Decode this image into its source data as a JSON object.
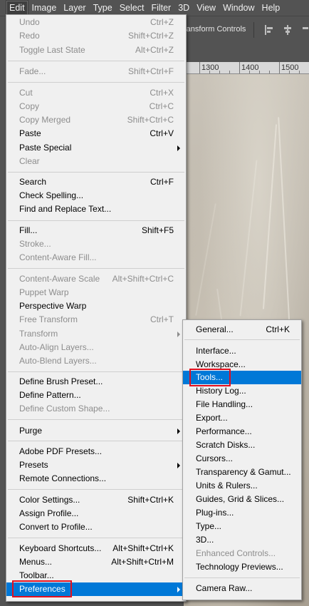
{
  "menubar": {
    "items": [
      "Edit",
      "Image",
      "Layer",
      "Type",
      "Select",
      "Filter",
      "3D",
      "View",
      "Window",
      "Help"
    ],
    "active": "Edit"
  },
  "options_bar": {
    "transform_controls_label": "ransform Controls"
  },
  "ruler": {
    "ticks": [
      "1300",
      "1400",
      "1500"
    ]
  },
  "edit_menu": {
    "items": [
      {
        "label": "Undo",
        "shortcut": "Ctrl+Z",
        "disabled": true
      },
      {
        "label": "Redo",
        "shortcut": "Shift+Ctrl+Z",
        "disabled": true
      },
      {
        "label": "Toggle Last State",
        "shortcut": "Alt+Ctrl+Z",
        "disabled": true
      },
      {
        "label": "Fade...",
        "shortcut": "Shift+Ctrl+F",
        "disabled": true
      },
      {
        "label": "Cut",
        "shortcut": "Ctrl+X",
        "disabled": true
      },
      {
        "label": "Copy",
        "shortcut": "Ctrl+C",
        "disabled": true
      },
      {
        "label": "Copy Merged",
        "shortcut": "Shift+Ctrl+C",
        "disabled": true
      },
      {
        "label": "Paste",
        "shortcut": "Ctrl+V",
        "disabled": false
      },
      {
        "label": "Paste Special",
        "shortcut": "",
        "disabled": false,
        "submenu": true
      },
      {
        "label": "Clear",
        "shortcut": "",
        "disabled": true
      },
      {
        "label": "Search",
        "shortcut": "Ctrl+F",
        "disabled": false
      },
      {
        "label": "Check Spelling...",
        "shortcut": "",
        "disabled": false
      },
      {
        "label": "Find and Replace Text...",
        "shortcut": "",
        "disabled": false
      },
      {
        "label": "Fill...",
        "shortcut": "Shift+F5",
        "disabled": false
      },
      {
        "label": "Stroke...",
        "shortcut": "",
        "disabled": true
      },
      {
        "label": "Content-Aware Fill...",
        "shortcut": "",
        "disabled": true
      },
      {
        "label": "Content-Aware Scale",
        "shortcut": "Alt+Shift+Ctrl+C",
        "disabled": true
      },
      {
        "label": "Puppet Warp",
        "shortcut": "",
        "disabled": true
      },
      {
        "label": "Perspective Warp",
        "shortcut": "",
        "disabled": false
      },
      {
        "label": "Free Transform",
        "shortcut": "Ctrl+T",
        "disabled": true
      },
      {
        "label": "Transform",
        "shortcut": "",
        "disabled": true,
        "submenu": true
      },
      {
        "label": "Auto-Align Layers...",
        "shortcut": "",
        "disabled": true
      },
      {
        "label": "Auto-Blend Layers...",
        "shortcut": "",
        "disabled": true
      },
      {
        "label": "Define Brush Preset...",
        "shortcut": "",
        "disabled": false
      },
      {
        "label": "Define Pattern...",
        "shortcut": "",
        "disabled": false
      },
      {
        "label": "Define Custom Shape...",
        "shortcut": "",
        "disabled": true
      },
      {
        "label": "Purge",
        "shortcut": "",
        "disabled": false,
        "submenu": true
      },
      {
        "label": "Adobe PDF Presets...",
        "shortcut": "",
        "disabled": false
      },
      {
        "label": "Presets",
        "shortcut": "",
        "disabled": false,
        "submenu": true
      },
      {
        "label": "Remote Connections...",
        "shortcut": "",
        "disabled": false
      },
      {
        "label": "Color Settings...",
        "shortcut": "Shift+Ctrl+K",
        "disabled": false
      },
      {
        "label": "Assign Profile...",
        "shortcut": "",
        "disabled": false
      },
      {
        "label": "Convert to Profile...",
        "shortcut": "",
        "disabled": false
      },
      {
        "label": "Keyboard Shortcuts...",
        "shortcut": "Alt+Shift+Ctrl+K",
        "disabled": false
      },
      {
        "label": "Menus...",
        "shortcut": "Alt+Shift+Ctrl+M",
        "disabled": false
      },
      {
        "label": "Toolbar...",
        "shortcut": "",
        "disabled": false
      },
      {
        "label": "Preferences",
        "shortcut": "",
        "disabled": false,
        "submenu": true,
        "highlighted": true
      }
    ]
  },
  "preferences_submenu": {
    "items": [
      {
        "label": "General...",
        "shortcut": "Ctrl+K",
        "disabled": false
      },
      {
        "label": "Interface...",
        "shortcut": "",
        "disabled": false
      },
      {
        "label": "Workspace...",
        "shortcut": "",
        "disabled": false
      },
      {
        "label": "Tools...",
        "shortcut": "",
        "disabled": false,
        "highlighted": true
      },
      {
        "label": "History Log...",
        "shortcut": "",
        "disabled": false
      },
      {
        "label": "File Handling...",
        "shortcut": "",
        "disabled": false
      },
      {
        "label": "Export...",
        "shortcut": "",
        "disabled": false
      },
      {
        "label": "Performance...",
        "shortcut": "",
        "disabled": false
      },
      {
        "label": "Scratch Disks...",
        "shortcut": "",
        "disabled": false
      },
      {
        "label": "Cursors...",
        "shortcut": "",
        "disabled": false
      },
      {
        "label": "Transparency & Gamut...",
        "shortcut": "",
        "disabled": false
      },
      {
        "label": "Units & Rulers...",
        "shortcut": "",
        "disabled": false
      },
      {
        "label": "Guides, Grid & Slices...",
        "shortcut": "",
        "disabled": false
      },
      {
        "label": "Plug-ins...",
        "shortcut": "",
        "disabled": false
      },
      {
        "label": "Type...",
        "shortcut": "",
        "disabled": false
      },
      {
        "label": "3D...",
        "shortcut": "",
        "disabled": false
      },
      {
        "label": "Enhanced Controls...",
        "shortcut": "",
        "disabled": true
      },
      {
        "label": "Technology Previews...",
        "shortcut": "",
        "disabled": false
      },
      {
        "label": "Camera Raw...",
        "shortcut": "",
        "disabled": false
      }
    ]
  },
  "colors": {
    "highlight": "#0078d7",
    "annotation": "#e01020"
  }
}
